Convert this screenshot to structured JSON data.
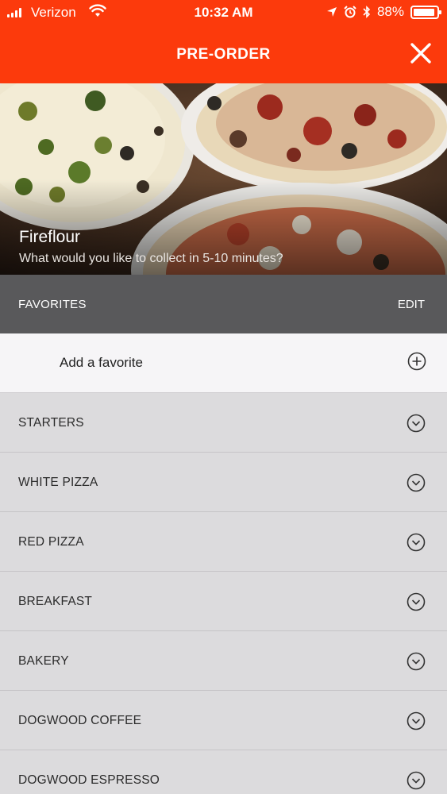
{
  "status_bar": {
    "carrier": "Verizon",
    "time": "10:32 AM",
    "battery": "88%"
  },
  "header": {
    "title": "PRE-ORDER"
  },
  "hero": {
    "restaurant": "Fireflour",
    "subtitle": "What would you like to collect in 5-10 minutes?"
  },
  "favorites": {
    "label": "FAVORITES",
    "edit_label": "EDIT",
    "add_label": "Add a favorite"
  },
  "categories": [
    "STARTERS",
    "WHITE PIZZA",
    "RED PIZZA",
    "BREAKFAST",
    "BAKERY",
    "DOGWOOD COFFEE",
    "DOGWOOD ESPRESSO"
  ],
  "colors": {
    "accent": "#fc3a0c",
    "favorites_bar": "#59595b",
    "list_bg": "#dcdbdd"
  }
}
